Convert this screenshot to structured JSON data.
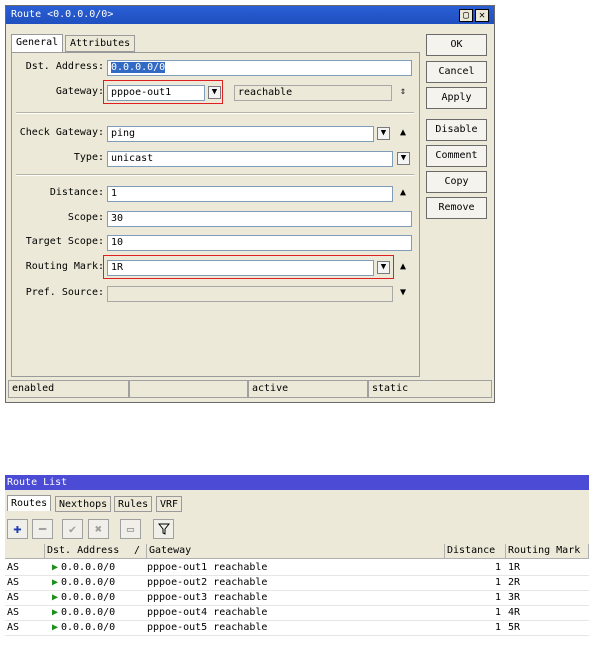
{
  "route_window": {
    "title": "Route <0.0.0.0/0>",
    "tabs": [
      "General",
      "Attributes"
    ],
    "fields": {
      "dst_address": {
        "label": "Dst. Address:",
        "value": "0.0.0.0/0"
      },
      "gateway": {
        "label": "Gateway:",
        "value": "pppoe-out1",
        "state": "reachable"
      },
      "check_gateway": {
        "label": "Check Gateway:",
        "value": "ping"
      },
      "type": {
        "label": "Type:",
        "value": "unicast"
      },
      "distance": {
        "label": "Distance:",
        "value": "1"
      },
      "scope": {
        "label": "Scope:",
        "value": "30"
      },
      "target_scope": {
        "label": "Target Scope:",
        "value": "10"
      },
      "routing_mark": {
        "label": "Routing Mark:",
        "value": "1R"
      },
      "pref_source": {
        "label": "Pref. Source:",
        "value": ""
      }
    },
    "buttons": [
      "OK",
      "Cancel",
      "Apply",
      "Disable",
      "Comment",
      "Copy",
      "Remove"
    ],
    "status": [
      "enabled",
      "",
      "active",
      "static"
    ]
  },
  "route_list": {
    "title": "Route List",
    "tabs": [
      "Routes",
      "Nexthops",
      "Rules",
      "VRF"
    ],
    "columns": [
      "",
      "Dst. Address",
      "Gateway",
      "Distance",
      "Routing Mark"
    ],
    "sort_indicator": "/",
    "rows": [
      {
        "flags": "AS",
        "dst": "0.0.0.0/0",
        "gateway": "pppoe-out1 reachable",
        "distance": "1",
        "mark": "1R"
      },
      {
        "flags": "AS",
        "dst": "0.0.0.0/0",
        "gateway": "pppoe-out2 reachable",
        "distance": "1",
        "mark": "2R"
      },
      {
        "flags": "AS",
        "dst": "0.0.0.0/0",
        "gateway": "pppoe-out3 reachable",
        "distance": "1",
        "mark": "3R"
      },
      {
        "flags": "AS",
        "dst": "0.0.0.0/0",
        "gateway": "pppoe-out4 reachable",
        "distance": "1",
        "mark": "4R"
      },
      {
        "flags": "AS",
        "dst": "0.0.0.0/0",
        "gateway": "pppoe-out5 reachable",
        "distance": "1",
        "mark": "5R"
      }
    ]
  },
  "colors": {
    "titlebar": "#1f4fbf",
    "highlight": "#e02020",
    "route_list_title": "#4b4bd6"
  }
}
